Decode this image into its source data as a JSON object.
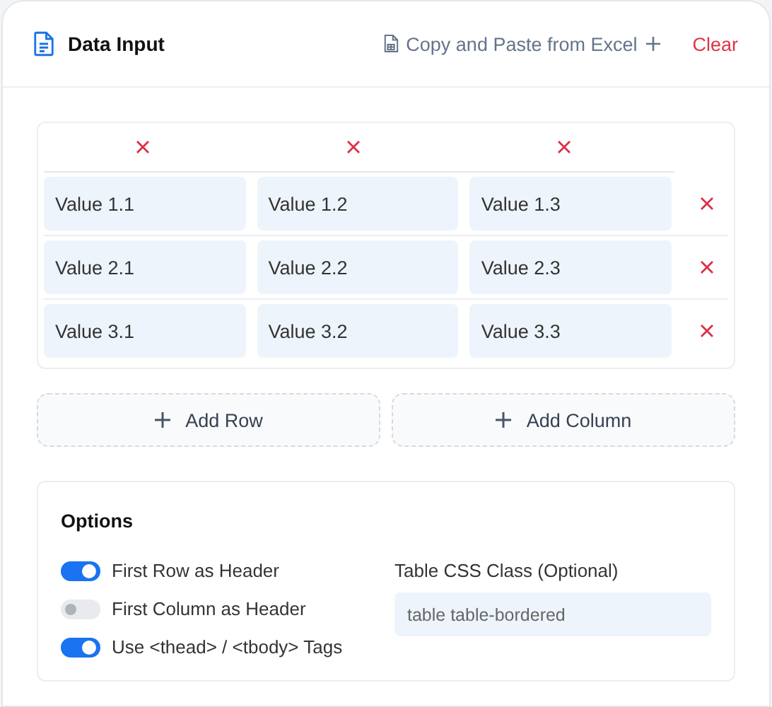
{
  "header": {
    "title": "Data Input",
    "paste_button": "Copy and Paste from Excel",
    "clear_button": "Clear"
  },
  "table": {
    "rows": [
      [
        "Value 1.1",
        "Value 1.2",
        "Value 1.3"
      ],
      [
        "Value 2.1",
        "Value 2.2",
        "Value 2.3"
      ],
      [
        "Value 3.1",
        "Value 3.2",
        "Value 3.3"
      ]
    ]
  },
  "actions": [
    "Add Row",
    "Add Column"
  ],
  "options": {
    "title": "Options",
    "toggles": [
      {
        "label": "First Row as Header",
        "on": true
      },
      {
        "label": "First Column as Header",
        "on": false
      },
      {
        "label": "Use <thead> / <tbody> Tags",
        "on": true
      }
    ],
    "css_class": {
      "label": "Table CSS Class (Optional)",
      "placeholder": "table table-bordered"
    }
  }
}
